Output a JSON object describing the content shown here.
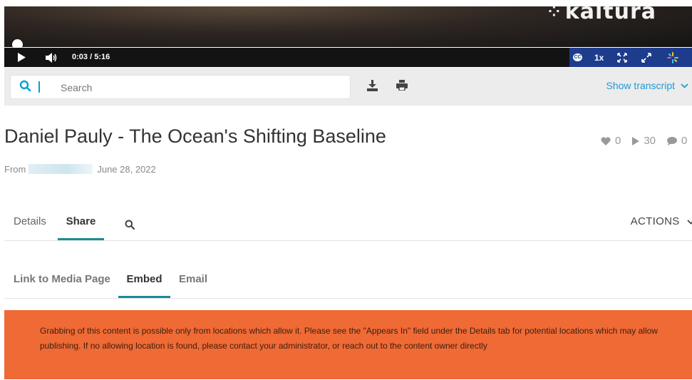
{
  "player": {
    "logo_text": "kaltura",
    "time_current": "0:03",
    "time_total": "/ 5:16",
    "progress_fraction": 0.0095,
    "speed_label": "1x",
    "cc_label": "CC"
  },
  "transcript_toolbar": {
    "search_placeholder": "Search",
    "show_transcript_label": "Show transcript"
  },
  "entry": {
    "title": "Daniel Pauly - The Ocean's Shifting Baseline",
    "from_label": "From",
    "date": "June 28, 2022",
    "likes": "0",
    "plays": "30",
    "comments": "0"
  },
  "main_tabs": {
    "details": "Details",
    "share": "Share",
    "actions": "ACTIONS"
  },
  "share_tabs": {
    "link": "Link to Media Page",
    "embed": "Embed",
    "email": "Email"
  },
  "alert": {
    "message": "Grabbing of this content is possible only from locations which allow it. Please see the \"Appears In\" field under the Details tab for potential locations which may allow publishing. If no allowing location is found, please contact your administrator, or reach out to the content owner directly"
  },
  "colors": {
    "accent_blue": "#00b5e2",
    "control_blue": "#1e3c8c",
    "tab_underline": "#1c8b95",
    "link_blue": "#1f9ad6",
    "alert_orange": "#f06a35"
  }
}
